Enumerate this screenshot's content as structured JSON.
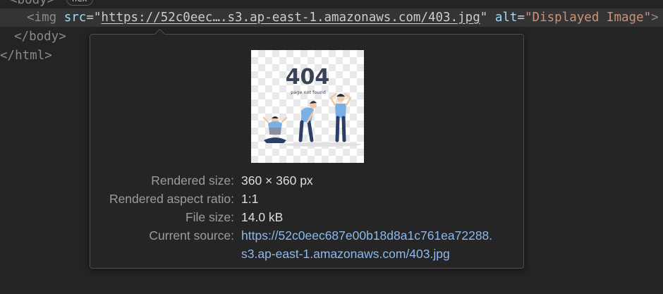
{
  "code": {
    "body_open_tag": "<body>",
    "flex_badge": "flex",
    "img_tag_open": "<img",
    "img_src_attr": "src",
    "img_src_value": "https://52c0eec….s3.ap-east-1.amazonaws.com/403.jpg",
    "img_alt_attr": "alt",
    "img_alt_value": "Displayed Image",
    "img_tag_close": ">",
    "body_close_tag": "</body>",
    "html_close_tag": "</html>"
  },
  "popup": {
    "preview": {
      "big_text": "404",
      "small_text": "page not found"
    },
    "rows": [
      {
        "label": "Rendered size:",
        "value": "360 × 360 px"
      },
      {
        "label": "Rendered aspect ratio:",
        "value": "1:1"
      },
      {
        "label": "File size:",
        "value": "14.0 kB"
      }
    ],
    "source_label": "Current source:",
    "source_url_line1": "https://52c0eec687e00b18d8a1c761ea72288.",
    "source_url_line2": "s3.ap-east-1.amazonaws.com/403.jpg"
  },
  "colors": {
    "background": "#242424",
    "highlight_line": "#343434",
    "popup_bg": "#252526",
    "link": "#8cb9ee",
    "attr_value": "#ce9178",
    "tag_name": "#569cd6"
  }
}
